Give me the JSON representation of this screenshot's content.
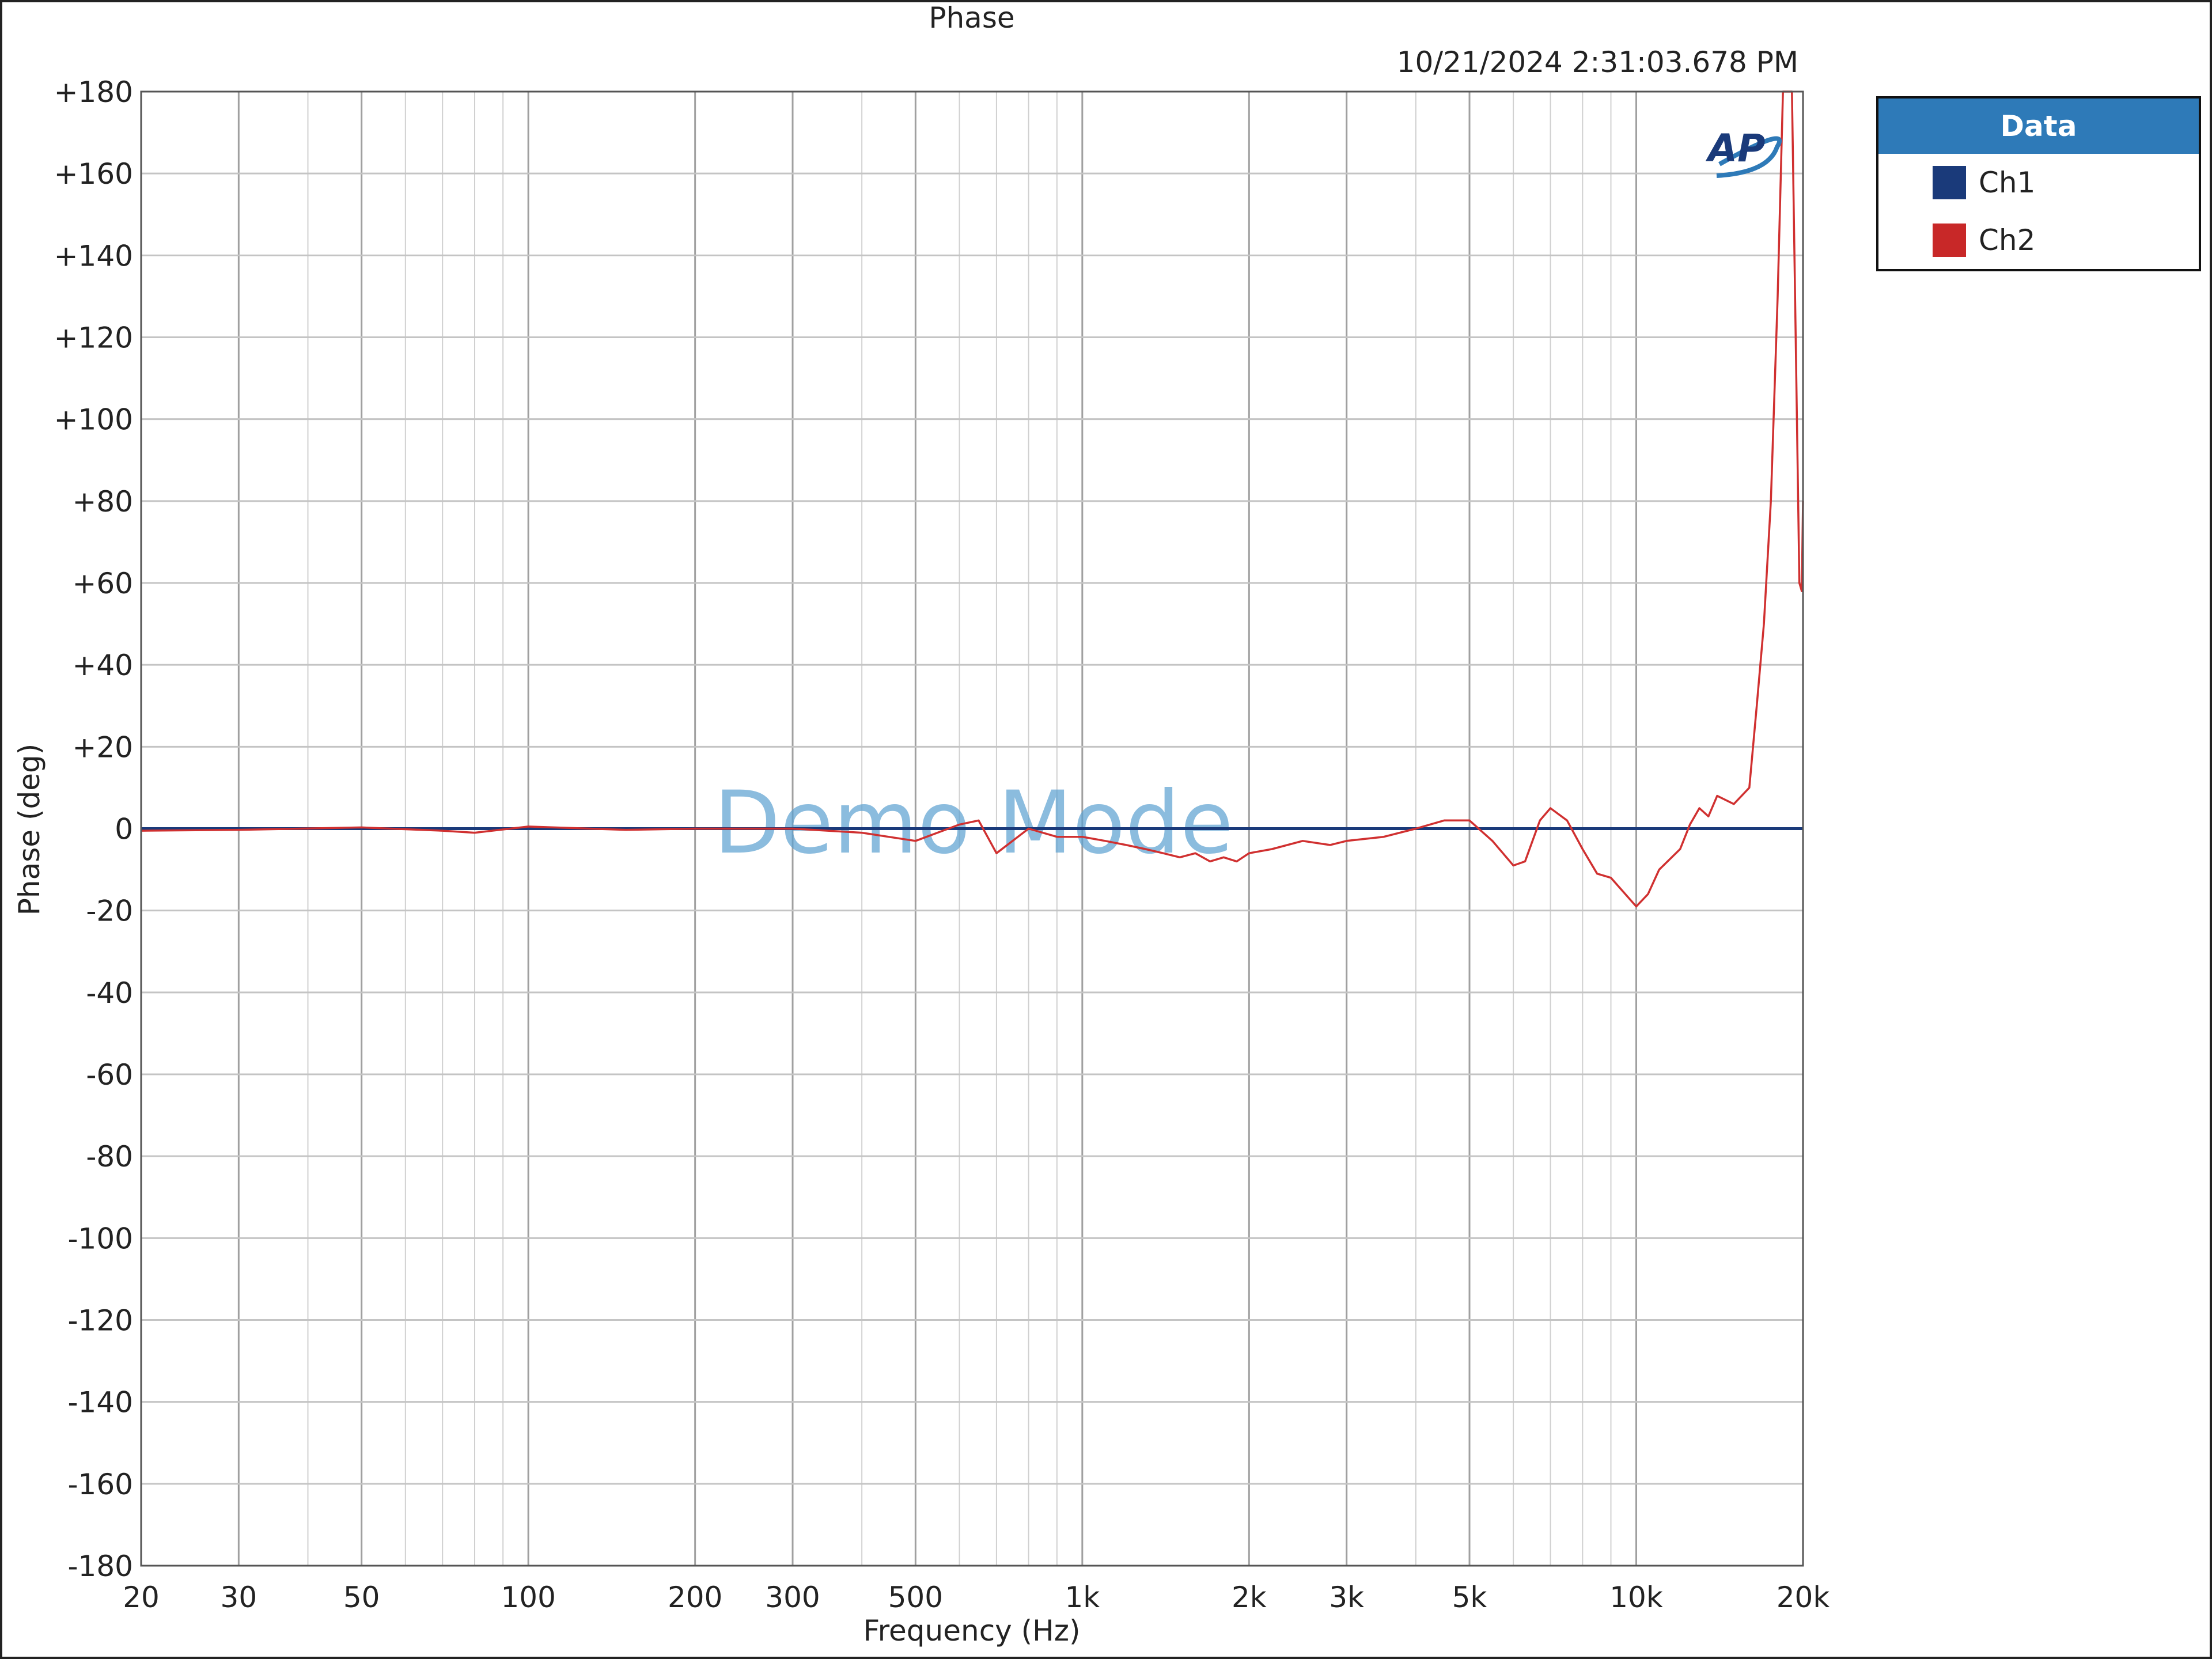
{
  "chart_data": {
    "type": "line",
    "title": "Phase",
    "timestamp": "10/21/2024 2:31:03.678 PM",
    "xlabel": "Frequency (Hz)",
    "ylabel": "Phase (deg)",
    "xscale": "log",
    "xlim": [
      20,
      20000
    ],
    "ylim": [
      -180,
      180
    ],
    "grid": true,
    "watermark": "Demo Mode",
    "logo": "AP",
    "xticks": [
      {
        "v": 20,
        "label": "20"
      },
      {
        "v": 30,
        "label": "30"
      },
      {
        "v": 50,
        "label": "50"
      },
      {
        "v": 100,
        "label": "100"
      },
      {
        "v": 200,
        "label": "200"
      },
      {
        "v": 300,
        "label": "300"
      },
      {
        "v": 500,
        "label": "500"
      },
      {
        "v": 1000,
        "label": "1k"
      },
      {
        "v": 2000,
        "label": "2k"
      },
      {
        "v": 3000,
        "label": "3k"
      },
      {
        "v": 5000,
        "label": "5k"
      },
      {
        "v": 10000,
        "label": "10k"
      },
      {
        "v": 20000,
        "label": "20k"
      }
    ],
    "yticks": [
      {
        "v": 180,
        "label": "+180"
      },
      {
        "v": 160,
        "label": "+160"
      },
      {
        "v": 140,
        "label": "+140"
      },
      {
        "v": 120,
        "label": "+120"
      },
      {
        "v": 100,
        "label": "+100"
      },
      {
        "v": 80,
        "label": "+80"
      },
      {
        "v": 60,
        "label": "+60"
      },
      {
        "v": 40,
        "label": "+40"
      },
      {
        "v": 20,
        "label": "+20"
      },
      {
        "v": 0,
        "label": "0"
      },
      {
        "v": -20,
        "label": "-20"
      },
      {
        "v": -40,
        "label": "-40"
      },
      {
        "v": -60,
        "label": "-60"
      },
      {
        "v": -80,
        "label": "-80"
      },
      {
        "v": -100,
        "label": "-100"
      },
      {
        "v": -120,
        "label": "-120"
      },
      {
        "v": -140,
        "label": "-140"
      },
      {
        "v": -160,
        "label": "-160"
      },
      {
        "v": -180,
        "label": "-180"
      }
    ],
    "legend": {
      "title": "Data",
      "placement": "right"
    },
    "series": [
      {
        "name": "Ch1",
        "color": "#1a3a7a",
        "x": [
          20,
          20000
        ],
        "y": [
          0,
          0
        ]
      },
      {
        "name": "Ch2",
        "color": "#d03030",
        "x": [
          20,
          30,
          50,
          70,
          80,
          100,
          150,
          200,
          300,
          400,
          500,
          600,
          650,
          700,
          800,
          900,
          1000,
          1100,
          1200,
          1300,
          1400,
          1500,
          1600,
          1700,
          1800,
          1900,
          2000,
          2200,
          2500,
          2800,
          3000,
          3500,
          4000,
          4500,
          5000,
          5500,
          6000,
          6300,
          6700,
          7000,
          7500,
          8000,
          8500,
          9000,
          10000,
          10500,
          11000,
          12000,
          12500,
          13000,
          13500,
          14000,
          15000,
          16000,
          16500,
          17000,
          17500,
          18000,
          18400,
          18800,
          19100,
          19400,
          19700,
          19900,
          20000
        ],
        "y": [
          -0.5,
          -0.3,
          0.3,
          -0.5,
          -1,
          0.5,
          -0.3,
          0,
          0,
          -1,
          -3,
          1,
          2,
          -6,
          0,
          -2,
          -2,
          -3,
          -4,
          -5,
          -6,
          -7,
          -6,
          -8,
          -7,
          -8,
          -6,
          -5,
          -3,
          -4,
          -3,
          -2,
          0,
          2,
          2,
          -3,
          -9,
          -8,
          2,
          5,
          2,
          -5,
          -11,
          -12,
          -19,
          -16,
          -10,
          -5,
          1,
          5,
          3,
          8,
          6,
          10,
          30,
          50,
          80,
          130,
          180,
          180,
          180,
          120,
          60,
          58,
          80
        ]
      }
    ]
  }
}
